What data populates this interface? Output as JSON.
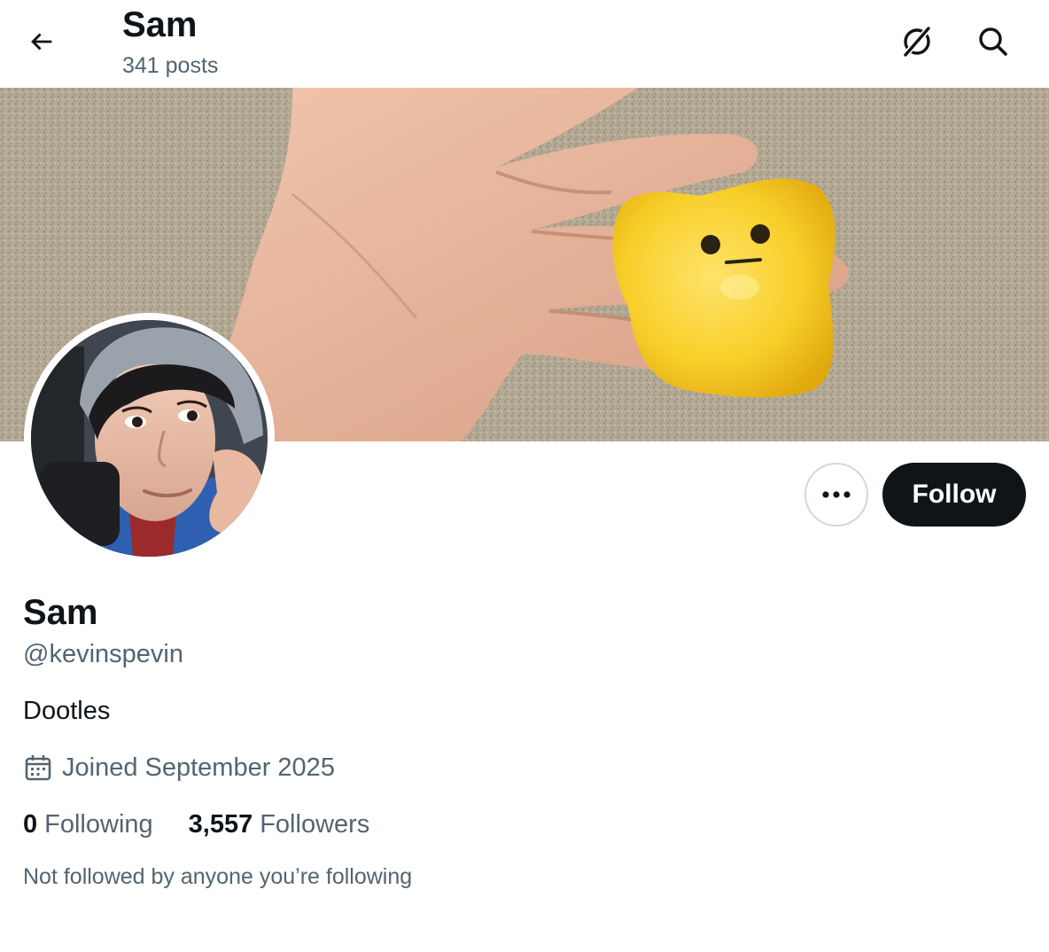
{
  "header": {
    "title": "Sam",
    "posts_count": "341 posts",
    "icons": [
      "back-arrow-icon",
      "grok-icon",
      "search-icon"
    ]
  },
  "banner": {
    "description": "banner photo"
  },
  "avatar": {
    "description": "profile photo"
  },
  "actions": {
    "more_icon": "more-dots-icon",
    "follow_label": "Follow"
  },
  "profile": {
    "name": "Sam",
    "handle": "@kevinspevin",
    "bio": "Dootles",
    "joined": "Joined September 2025",
    "joined_icon": "calendar-icon"
  },
  "stats": {
    "following_count": "0",
    "following_label": "Following",
    "followers_count": "3,557",
    "followers_label": "Followers"
  },
  "social_context": "Not followed by anyone you’re following",
  "colors": {
    "text_primary": "#0f1419",
    "text_secondary": "#536471",
    "follow_button_bg": "#0f1419",
    "border": "#cfd9de"
  }
}
